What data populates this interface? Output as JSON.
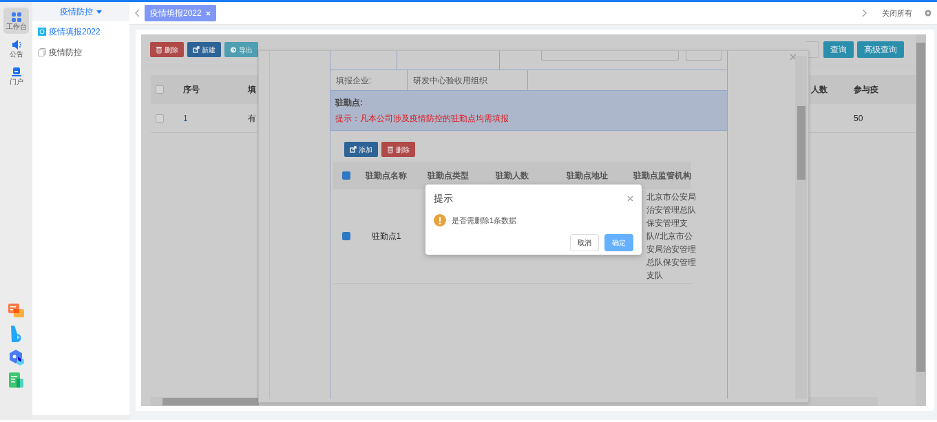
{
  "rail": {
    "items": [
      {
        "label": "工作台",
        "selected": true
      },
      {
        "label": "公告",
        "selected": false
      },
      {
        "label": "门户",
        "selected": false
      }
    ]
  },
  "tabs": [
    {
      "label": "疫情填报2022",
      "selected": true
    }
  ],
  "close_all": "关闭所有",
  "sidebar": {
    "header": "疫情防控",
    "items": [
      {
        "label": "疫情填报2022",
        "selected": true
      },
      {
        "label": "疫情防控",
        "selected": false
      }
    ]
  },
  "page": {
    "toolbar": [
      {
        "label": "删除",
        "kind": "danger"
      },
      {
        "label": "新建",
        "kind": "primary"
      },
      {
        "label": "导出",
        "kind": "info"
      }
    ],
    "search_buttons": [
      "查询",
      "高级查询"
    ],
    "table": {
      "all_checked": false,
      "columns": [
        "序号",
        "填",
        "人数",
        "参与疫"
      ],
      "rows": [
        {
          "checked": false,
          "number": "1",
          "column_3": "有",
          "column_5": "50"
        }
      ]
    }
  },
  "modal": {
    "form": [
      {
        "label": "填报企业:",
        "value": "研发中心验收用组织"
      }
    ],
    "section": {
      "title": "驻勤点:",
      "hint": "提示：凡本公司涉及疫情防控的驻勤点均需填报"
    },
    "buttons": [
      {
        "label": "添加",
        "kind": "primary"
      },
      {
        "label": "删除",
        "kind": "danger"
      }
    ],
    "table": {
      "all_checked": true,
      "columns": [
        "驻勤点名称",
        "驻勤点类型",
        "驻勤人数",
        "驻勤点地址",
        "驻勤点监管机构"
      ],
      "rows": [
        {
          "checked": true,
          "name": "驻勤点1",
          "authority": "北京市公安局治安管理总队保安管理支队//北京市公安局治安管理总队保安管理支队"
        }
      ]
    }
  },
  "dialog": {
    "title": "提示",
    "message": "是否需删除1条数据",
    "buttons": [
      {
        "label": "取消",
        "kind": "default"
      },
      {
        "label": "确定",
        "kind": "primary"
      }
    ]
  }
}
